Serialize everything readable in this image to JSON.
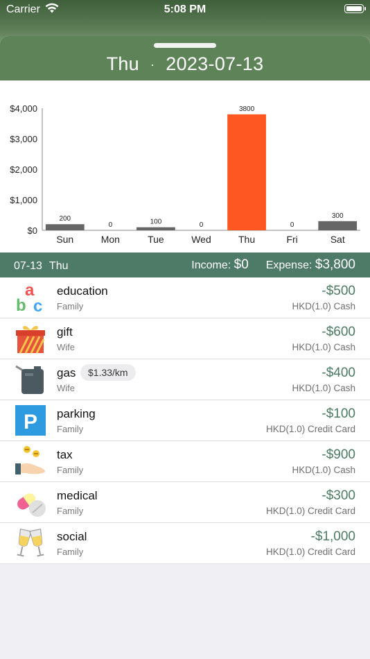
{
  "status": {
    "carrier": "Carrier",
    "time": "5:08 PM"
  },
  "header": {
    "weekday": "Thu",
    "separator": "·",
    "date": "2023-07-13"
  },
  "chart_data": {
    "type": "bar",
    "categories": [
      "Sun",
      "Mon",
      "Tue",
      "Wed",
      "Thu",
      "Fri",
      "Sat"
    ],
    "values": [
      200,
      0,
      100,
      0,
      3800,
      0,
      300
    ],
    "value_labels": [
      "200",
      "0",
      "100",
      "0",
      "3800",
      "0",
      "300"
    ],
    "ylim": [
      0,
      4000
    ],
    "yticks": [
      0,
      1000,
      2000,
      3000,
      4000
    ],
    "ytick_labels": [
      "$0",
      "$1,000",
      "$2,000",
      "$3,000",
      "$4,000"
    ],
    "highlight_index": 4,
    "bar_color": "#666666",
    "highlight_color": "#ff5722",
    "grid": false,
    "title": "",
    "xlabel": "",
    "ylabel": ""
  },
  "day_summary": {
    "date": "07-13",
    "weekday": "Thu",
    "income_label": "Income:",
    "income_value": "$0",
    "expense_label": "Expense:",
    "expense_value": "$3,800"
  },
  "transactions": [
    {
      "category": "education",
      "member": "Family",
      "amount": "-$500",
      "account": "HKD(1.0) Cash",
      "icon": "abc-letters-icon"
    },
    {
      "category": "gift",
      "member": "Wife",
      "amount": "-$600",
      "account": "HKD(1.0) Cash",
      "icon": "gift-box-icon"
    },
    {
      "category": "gas",
      "member": "Wife",
      "amount": "-$400",
      "account": "HKD(1.0) Cash",
      "icon": "fuel-can-icon",
      "badge": "$1.33/km"
    },
    {
      "category": "parking",
      "member": "Family",
      "amount": "-$100",
      "account": "HKD(1.0) Credit Card",
      "icon": "parking-sign-icon"
    },
    {
      "category": "tax",
      "member": "Family",
      "amount": "-$900",
      "account": "HKD(1.0) Cash",
      "icon": "hand-coins-icon"
    },
    {
      "category": "medical",
      "member": "Family",
      "amount": "-$300",
      "account": "HKD(1.0) Credit Card",
      "icon": "pills-icon"
    },
    {
      "category": "social",
      "member": "Family",
      "amount": "-$1,000",
      "account": "HKD(1.0) Credit Card",
      "icon": "wine-glasses-icon"
    }
  ]
}
